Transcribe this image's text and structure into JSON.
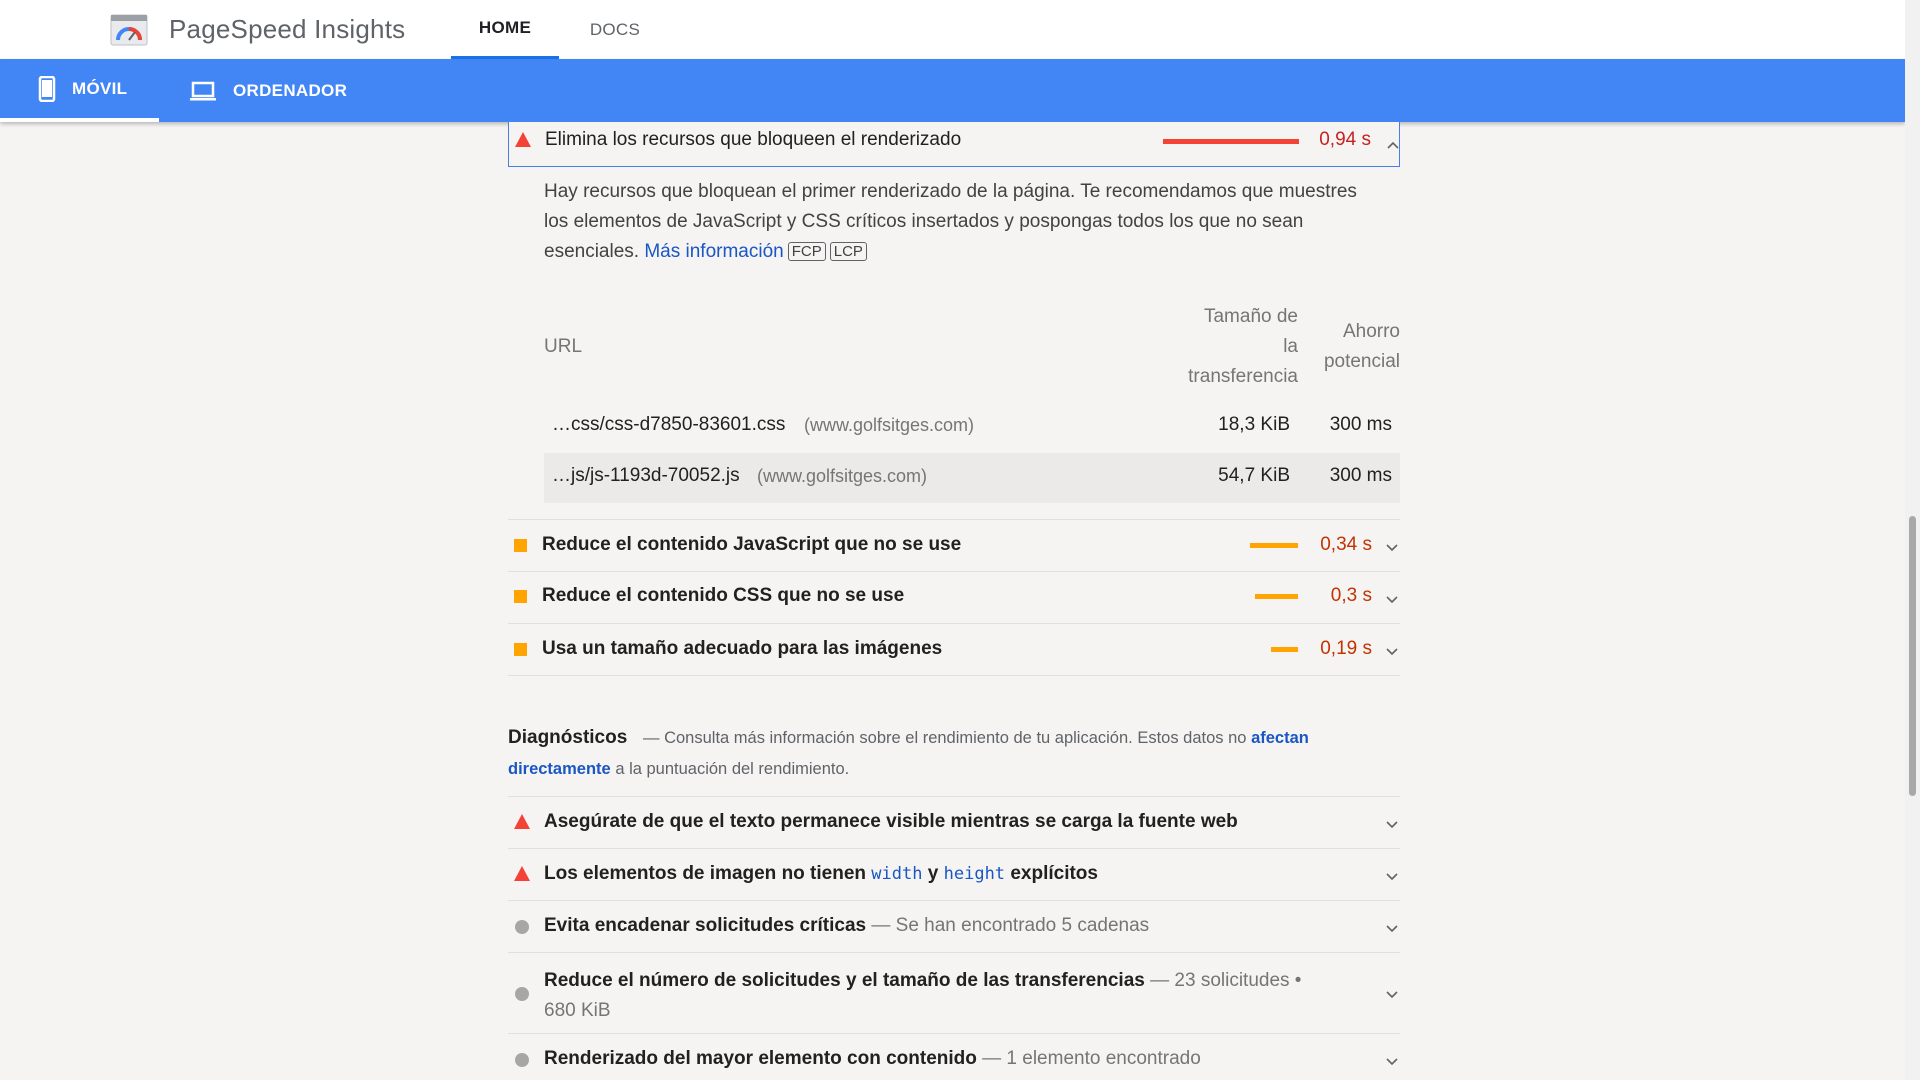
{
  "app": {
    "title": "PageSpeed Insights",
    "logo_icon": "pagespeed-logo-icon"
  },
  "top_tabs": [
    {
      "label": "HOME",
      "active": true
    },
    {
      "label": "DOCS",
      "active": false
    }
  ],
  "device_tabs": [
    {
      "label": "MÓVIL",
      "icon": "smartphone-icon",
      "active": true
    },
    {
      "label": "ORDENADOR",
      "icon": "laptop-icon",
      "active": false
    }
  ],
  "open_audit": {
    "title": "Elimina los recursos que bloqueen el renderizado",
    "value": "0,94 s",
    "severity": "fail",
    "bar_fraction": 1.0,
    "description": "Hay recursos que bloquean el primer renderizado de la página. Te recomendamos que muestres los elementos de JavaScript y CSS críticos insertados y pospongas todos los que no sean esenciales.",
    "learn_more": "Más información",
    "tags": [
      "FCP",
      "LCP"
    ],
    "table": {
      "headers": {
        "url": "URL",
        "transfer_line1": "Tamaño de",
        "transfer_line2": "la",
        "transfer_line3": "transferencia",
        "savings_line1": "Ahorro",
        "savings_line2": "potencial"
      },
      "rows": [
        {
          "url": "…css/css-d7850-83601.css",
          "host": "(www.golfsitges.com)",
          "size": "18,3 KiB",
          "savings": "300 ms"
        },
        {
          "url": "…js/js-1193d-70052.js",
          "host": "(www.golfsitges.com)",
          "size": "54,7 KiB",
          "savings": "300 ms"
        }
      ]
    }
  },
  "opportunities": [
    {
      "title": "Reduce el contenido JavaScript que no se use",
      "value": "0,34 s",
      "severity": "average",
      "bar_fraction": 0.36
    },
    {
      "title": "Reduce el contenido CSS que no se use",
      "value": "0,3 s",
      "severity": "average",
      "bar_fraction": 0.31
    },
    {
      "title": "Usa un tamaño adecuado para las imágenes",
      "value": "0,19 s",
      "severity": "average",
      "bar_fraction": 0.2
    }
  ],
  "diagnostics": {
    "title": "Diagnósticos",
    "desc_prefix": "— Consulta más información sobre el rendimiento de tu aplicación. Estos datos no",
    "desc_link_1": "afectan",
    "desc_link_2": "directamente",
    "desc_suffix": "a la puntuación del rendimiento.",
    "items": [
      {
        "title": "Asegúrate de que el texto permanece visible mientras se carga la fuente web",
        "severity": "fail"
      },
      {
        "title_pre": "Los elementos de imagen no tienen",
        "code1": "width",
        "mid": "y",
        "code2": "height",
        "title_post": "explícitos",
        "severity": "fail"
      },
      {
        "title": "Evita encadenar solicitudes críticas",
        "subtitle": "— Se han encontrado 5 cadenas",
        "severity": "info"
      },
      {
        "title": "Reduce el número de solicitudes y el tamaño de las transferencias",
        "subtitle_line1": "— 23 solicitudes •",
        "subtitle_line2": "680 KiB",
        "severity": "info"
      },
      {
        "title": "Renderizado del mayor elemento con contenido",
        "subtitle": "— 1 elemento encontrado",
        "severity": "info"
      }
    ]
  },
  "colors": {
    "fail": "#f44336",
    "average": "#ffa400",
    "info": "#a6a6a6",
    "accent": "#4285f4",
    "link": "#1a56c4"
  }
}
